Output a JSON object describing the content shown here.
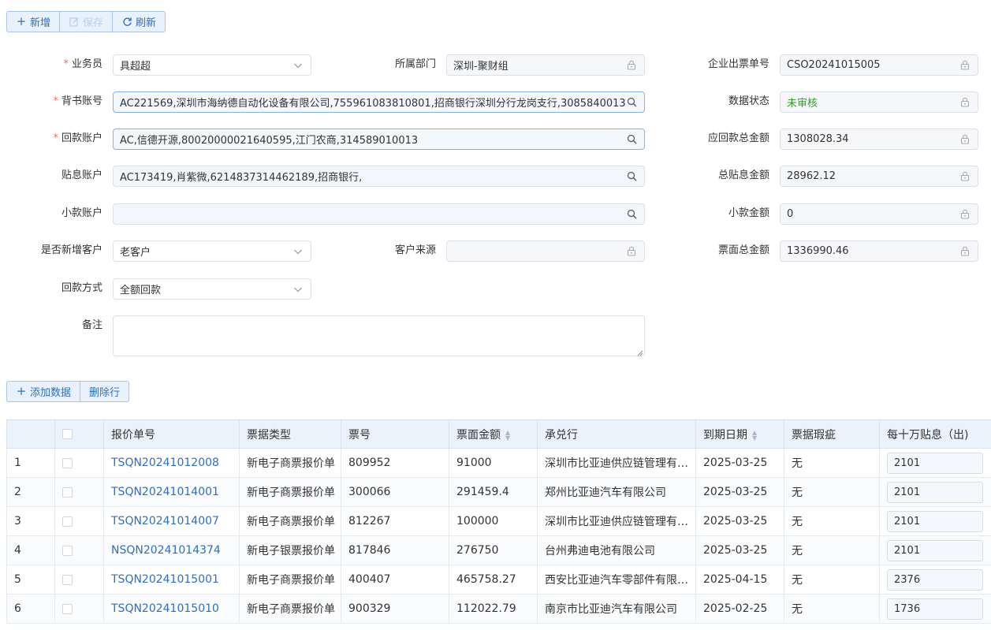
{
  "toolbar": {
    "add_label": "新增",
    "save_label": "保存",
    "refresh_label": "刷新"
  },
  "form": {
    "salesperson": {
      "label": "业务员",
      "value": "具超超"
    },
    "department": {
      "label": "所属部门",
      "value": "深圳-聚财组"
    },
    "order_no": {
      "label": "企业出票单号",
      "value": "CSO20241015005"
    },
    "endorse_account": {
      "label": "背书账号",
      "value": "AC221569,深圳市海纳德自动化设备有限公司,755961083810801,招商银行深圳分行龙岗支行,3085840013"
    },
    "data_status": {
      "label": "数据状态",
      "value": "未审核"
    },
    "payback_account": {
      "label": "回款账户",
      "value": "AC,信德开源,80020000021640595,江门农商,314589010013"
    },
    "receivable_total": {
      "label": "应回款总金额",
      "value": "1308028.34"
    },
    "interest_account": {
      "label": "贴息账户",
      "value": "AC173419,肖紫微,6214837314462189,招商银行,"
    },
    "interest_total": {
      "label": "总贴息金额",
      "value": "28962.12"
    },
    "small_account": {
      "label": "小款账户",
      "value": ""
    },
    "small_amount": {
      "label": "小款金额",
      "value": "0"
    },
    "new_customer": {
      "label": "是否新增客户",
      "value": "老客户"
    },
    "customer_source": {
      "label": "客户来源",
      "value": ""
    },
    "face_total": {
      "label": "票面总金额",
      "value": "1336990.46"
    },
    "payback_method": {
      "label": "回款方式",
      "value": "全额回款"
    },
    "remark": {
      "label": "备注",
      "value": ""
    }
  },
  "table_toolbar": {
    "add_row_label": "添加数据",
    "delete_row_label": "删除行"
  },
  "table": {
    "headers": [
      "报价单号",
      "票据类型",
      "票号",
      "票面金额",
      "承兑行",
      "到期日期",
      "票据瑕疵",
      "每十万贴息（出)"
    ],
    "rows": [
      {
        "idx": "1",
        "quote_no": "TSQN20241012008",
        "type": "新电子商票报价单",
        "bill_no": "809952",
        "amount": "91000",
        "bank": "深圳市比亚迪供应链管理有限公司",
        "due": "2025-03-25",
        "defect": "无",
        "interest": "2101"
      },
      {
        "idx": "2",
        "quote_no": "TSQN20241014001",
        "type": "新电子商票报价单",
        "bill_no": "300066",
        "amount": "291459.4",
        "bank": "郑州比亚迪汽车有限公司",
        "due": "2025-03-25",
        "defect": "无",
        "interest": "2101"
      },
      {
        "idx": "3",
        "quote_no": "TSQN20241014007",
        "type": "新电子商票报价单",
        "bill_no": "812267",
        "amount": "100000",
        "bank": "深圳市比亚迪供应链管理有限公司",
        "due": "2025-03-25",
        "defect": "无",
        "interest": "2101"
      },
      {
        "idx": "4",
        "quote_no": "NSQN20241014374",
        "type": "新电子银票报价单",
        "bill_no": "817846",
        "amount": "276750",
        "bank": "台州弗迪电池有限公司",
        "due": "2025-03-25",
        "defect": "无",
        "interest": "2101"
      },
      {
        "idx": "5",
        "quote_no": "TSQN20241015001",
        "type": "新电子商票报价单",
        "bill_no": "400407",
        "amount": "465758.27",
        "bank": "西安比亚迪汽车零部件有限公司",
        "due": "2025-04-15",
        "defect": "无",
        "interest": "2376"
      },
      {
        "idx": "6",
        "quote_no": "TSQN20241015010",
        "type": "新电子商票报价单",
        "bill_no": "900329",
        "amount": "112022.79",
        "bank": "南京市比亚迪汽车有限公司",
        "due": "2025-02-25",
        "defect": "无",
        "interest": "1736"
      }
    ]
  },
  "colors": {
    "accent": "#2f6fc0",
    "required": "#f56c6c",
    "status_green": "#3a9b2c",
    "header_bg": "#eaf2fb"
  }
}
